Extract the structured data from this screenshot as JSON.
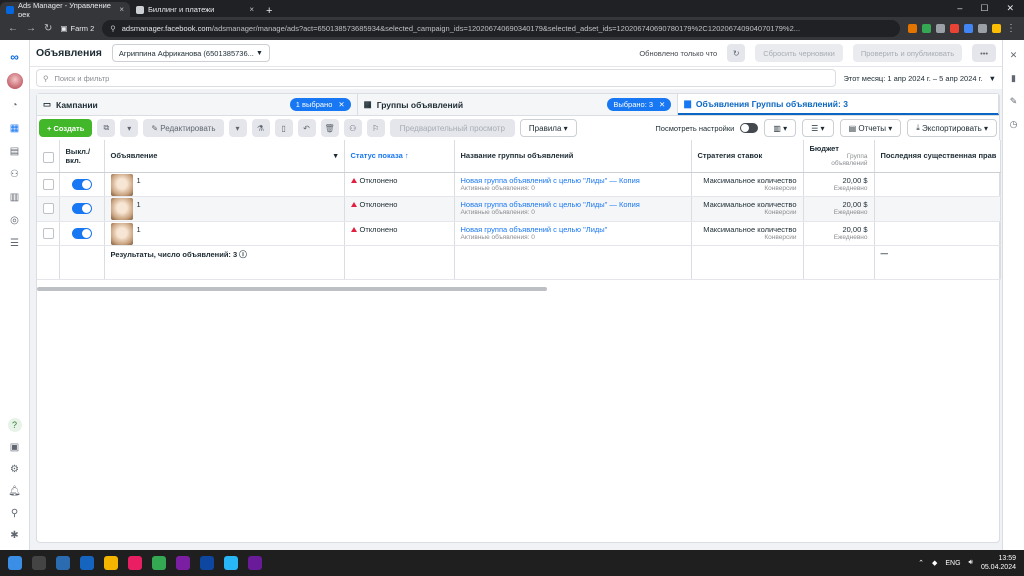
{
  "browser": {
    "tabs": [
      {
        "title": "Ads Manager - Управление рек",
        "active": true
      },
      {
        "title": "Биллинг и платежи",
        "active": false
      }
    ],
    "profile": "Farm 2",
    "url_host": "adsmanager.facebook.com",
    "url_rest": "/adsmanager/manage/ads?act=650138573685934&selected_campaign_ids=120206740690340179&selected_adset_ids=120206740690780179%2C120206740904070179%2..."
  },
  "header": {
    "title": "Объявления",
    "account": "Агриппина Африканова (6501385736...",
    "updated": "Обновлено только что",
    "discard": "Сбросить черновики",
    "publish": "Проверить и опубликовать",
    "more": "•••"
  },
  "search": {
    "placeholder": "Поиск и фильтр",
    "daterange": "Этот месяц: 1 апр 2024 г. – 5 апр 2024 г."
  },
  "tabs": {
    "campaigns": "Кампании",
    "campaigns_pill": "1 выбрано",
    "adsets": "Группы объявлений",
    "adsets_pill": "Выбрано: 3",
    "ads": "Объявления Группы объявлений: 3"
  },
  "toolbar": {
    "create": "+ Создать",
    "edit": "Редактировать",
    "preview": "Предварительный просмотр",
    "rules": "Правила",
    "view_settings": "Посмотреть настройки",
    "reports": "Отчеты",
    "export": "Экспортировать"
  },
  "columns": {
    "onoff": "Выкл./вкл.",
    "ad": "Объявление",
    "status": "Статус показа ↑",
    "adset": "Название группы объявлений",
    "bid": "Стратегия ставок",
    "bid_sub": "",
    "budget": "Бюджет",
    "budget_sub": "Группа объявлений",
    "last_edit": "Последняя существенная прав"
  },
  "rows": [
    {
      "name": "1",
      "status": "Отклонено",
      "adset": "Новая группа объявлений с целью \"Лиды\" — Копия",
      "adset_sub": "Активные объявления: 0",
      "bid": "Максимальное количество",
      "bid_sub": "Конверсии",
      "budget": "20,00 $",
      "budget_sub": "Ежедневно"
    },
    {
      "name": "1",
      "status": "Отклонено",
      "adset": "Новая группа объявлений с целью \"Лиды\" — Копия",
      "adset_sub": "Активные объявления: 0",
      "bid": "Максимальное количество",
      "bid_sub": "Конверсии",
      "budget": "20,00 $",
      "budget_sub": "Ежедневно"
    },
    {
      "name": "1",
      "status": "Отклонено",
      "adset": "Новая группа объявлений с целью \"Лиды\"",
      "adset_sub": "Активные объявления: 0",
      "bid": "Максимальное количество",
      "bid_sub": "Конверсии",
      "budget": "20,00 $",
      "budget_sub": "Ежедневно"
    }
  ],
  "totals": {
    "label": "Результаты, число объявлений: 3",
    "last": "—"
  },
  "taskbar": {
    "lang": "ENG",
    "time": "13:59",
    "date": "05.04.2024"
  }
}
